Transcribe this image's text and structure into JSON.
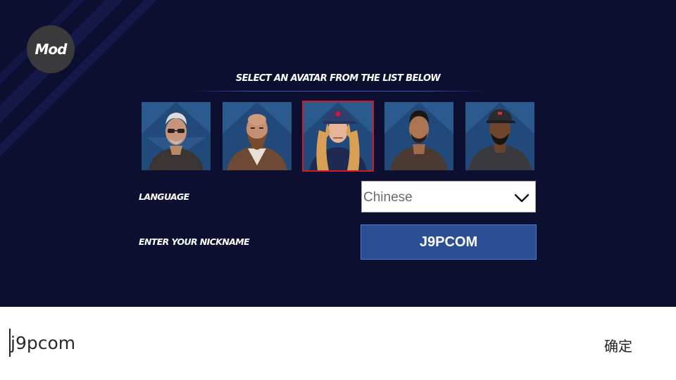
{
  "app": {
    "mod_badge": "Mod",
    "heading": "SELECT AN AVATAR FROM THE LIST BELOW"
  },
  "avatars": [
    {
      "name": "avatar-old-man-glasses",
      "selected": false
    },
    {
      "name": "avatar-bald-bearded-man",
      "selected": false
    },
    {
      "name": "avatar-woman-cap",
      "selected": true
    },
    {
      "name": "avatar-young-man",
      "selected": false
    },
    {
      "name": "avatar-man-cap",
      "selected": false
    }
  ],
  "form": {
    "language_label": "LANGUAGE",
    "language_value": "Chinese",
    "nickname_label": "ENTER YOUR NICKNAME",
    "nickname_value": "J9PCOM"
  },
  "keyboard_bar": {
    "input_text": "j9pcom",
    "confirm_label": "确定"
  },
  "colors": {
    "background": "#0c0f30",
    "selected_border": "#d21a22",
    "nickname_box": "#2a4f94"
  },
  "icons": {
    "dropdown": "chevron-down-icon"
  }
}
